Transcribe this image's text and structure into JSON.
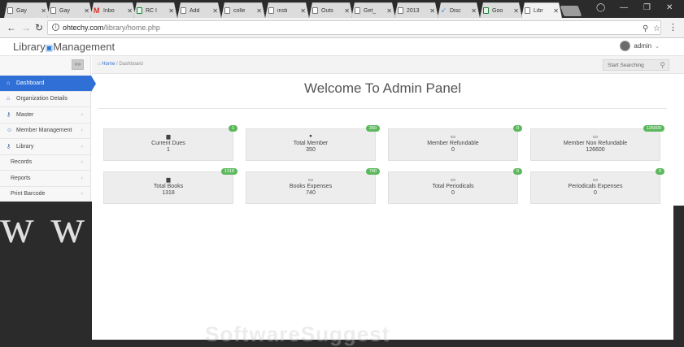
{
  "browser": {
    "tabs": [
      {
        "label": "Gay",
        "icon": "page-icon"
      },
      {
        "label": "Gay",
        "icon": "page-icon"
      },
      {
        "label": "Inbo",
        "icon": "gmail-icon"
      },
      {
        "label": "RC I",
        "icon": "sheets-icon"
      },
      {
        "label": "Add",
        "icon": "page-icon"
      },
      {
        "label": "colle",
        "icon": "page-icon"
      },
      {
        "label": "insti",
        "icon": "page-icon"
      },
      {
        "label": "Outs",
        "icon": "page-icon"
      },
      {
        "label": "Get_",
        "icon": "page-icon"
      },
      {
        "label": "2013",
        "icon": "page-icon"
      },
      {
        "label": "Disc",
        "icon": "rocket-icon"
      },
      {
        "label": "Goo",
        "icon": "sheets-icon"
      },
      {
        "label": "Libr",
        "icon": "page-icon",
        "active": true
      }
    ],
    "close_glyph": "✕",
    "url_domain": "ohtechy.com",
    "url_path": "/library/home.php"
  },
  "app": {
    "brand_left": "Library",
    "brand_right": "Management",
    "user_name": "admin",
    "sidebar": {
      "items": [
        {
          "label": "Dashboard",
          "icon": "home-icon",
          "active": true,
          "chevron": false
        },
        {
          "label": "Organization Details",
          "icon": "home-icon",
          "chevron": false
        },
        {
          "label": "Master",
          "icon": "key-icon",
          "chevron": true
        },
        {
          "label": "Member Management",
          "icon": "users-icon",
          "chevron": true
        },
        {
          "label": "Library",
          "icon": "key-icon",
          "chevron": true
        },
        {
          "label": "Records",
          "icon": "",
          "chevron": true
        },
        {
          "label": "Reports",
          "icon": "",
          "chevron": true
        },
        {
          "label": "Print Barcode",
          "icon": "",
          "chevron": true
        }
      ]
    },
    "breadcrumb": {
      "home": "Home",
      "separator": "/",
      "current": "Dashboard"
    },
    "search_placeholder": "Start Searching",
    "title": "Welcome To Admin Panel",
    "cards": [
      {
        "label": "Current Dues",
        "value": "1",
        "badge": "1",
        "icon": "book-icon"
      },
      {
        "label": "Total Member",
        "value": "350",
        "badge": "350",
        "icon": "user-icon"
      },
      {
        "label": "Member Refundable",
        "value": "0",
        "badge": "0",
        "icon": "money-icon"
      },
      {
        "label": "Member Non Refundable",
        "value": "126600",
        "badge": "126600",
        "icon": "money-icon"
      },
      {
        "label": "Total Books",
        "value": "1318",
        "badge": "1318",
        "icon": "book-icon"
      },
      {
        "label": "Books Expenses",
        "value": "740",
        "badge": "740",
        "icon": "money-icon"
      },
      {
        "label": "Total Periodicals",
        "value": "0",
        "badge": "0",
        "icon": "money-icon"
      },
      {
        "label": "Periodicals Expenses",
        "value": "0",
        "badge": "0",
        "icon": "money-icon"
      }
    ]
  },
  "watermark": {
    "text": "SoftwareSuggest"
  },
  "colors": {
    "accent": "#2f6fd6",
    "badge": "#5cb85c"
  }
}
